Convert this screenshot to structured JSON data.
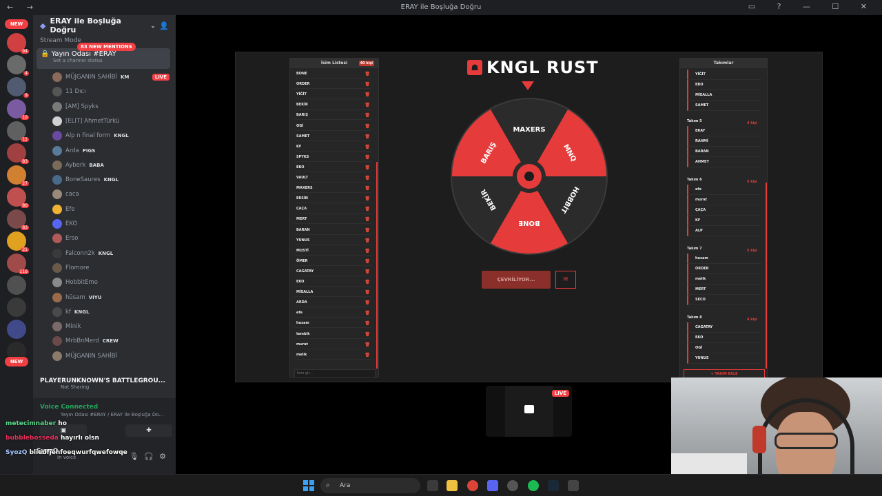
{
  "window": {
    "title": "ERAY ile Boşluğa Doğru",
    "nav": "← →",
    "controls": "▭ ? — ☐ ✕"
  },
  "servers": {
    "new_top": "NEW",
    "new_bottom": "NEW",
    "badges": [
      "94",
      "4",
      "9",
      "10",
      "11",
      "83",
      "27",
      "80",
      "83",
      "21",
      "116"
    ]
  },
  "sidebar": {
    "server_name": "ERAY ile Boşluğa Doğru",
    "stream_mode": "Stream Mode",
    "mentions": "83 NEW MENTIONS",
    "current_channel": "Yayın Odası #ERAY",
    "channel_status": "Set a channel status",
    "members": [
      {
        "name": "MÜJGANIN SAHİBİ",
        "tag": "KM",
        "live": "LIVE",
        "color": "#8a6a5a"
      },
      {
        "name": "11 Dıcı",
        "tag": "",
        "color": "#555"
      },
      {
        "name": "[AM] Spyks",
        "tag": "",
        "color": "#7a7a7a"
      },
      {
        "name": "[ELIT] AhmetTürkü",
        "tag": "",
        "color": "#d0d0d0"
      },
      {
        "name": "Alp n final form",
        "tag": "KNGL",
        "color": "#6a4aa0"
      },
      {
        "name": "Arda",
        "tag": "PIGS",
        "color": "#5a7a9a"
      },
      {
        "name": "Ayberk",
        "tag": "BABA",
        "color": "#7a6a5a"
      },
      {
        "name": "BoneSaures",
        "tag": "KNGL",
        "color": "#4a6a8a"
      },
      {
        "name": "caca",
        "tag": "",
        "color": "#9a8a7a"
      },
      {
        "name": "Efe",
        "tag": "",
        "color": "#f0b232"
      },
      {
        "name": "EKO",
        "tag": "",
        "color": "#5865f2"
      },
      {
        "name": "Erso",
        "tag": "",
        "color": "#b05a5a"
      },
      {
        "name": "Falconn2k",
        "tag": "KNGL",
        "color": "#3a3a3a"
      },
      {
        "name": "Flomore",
        "tag": "",
        "color": "#6a5a4a"
      },
      {
        "name": "HobbitEmo",
        "tag": "",
        "color": "#8a8a8a"
      },
      {
        "name": "hüsam",
        "tag": "VIYU",
        "color": "#9a6a4a"
      },
      {
        "name": "kf",
        "tag": "KNGL",
        "color": "#4a4a4a"
      },
      {
        "name": "Minik",
        "tag": "",
        "color": "#7a6a6a"
      },
      {
        "name": "MrbBnMerd",
        "tag": "CREW",
        "color": "#6a4a4a"
      },
      {
        "name": "MÜJGANIN SAHİBİ",
        "tag": "",
        "color": "#8a7a6a"
      }
    ],
    "activity_title": "PLAYERUNKNOWN'S BATTLEGROU...",
    "activity_sub": "Not Sharing",
    "voice_status": "Voice Connected",
    "voice_channel": "Yayın Odası #ERAY / ERAY ile Boşluğa Do...",
    "user_name": "SyozQ",
    "user_status": "In voice"
  },
  "chat_overlay": [
    {
      "user": "metecimnaber",
      "msg": "ho"
    },
    {
      "user": "bubblebosseda",
      "msg": "hayırlı olsn"
    },
    {
      "user": "SyozQ",
      "msg": "bliedfjehfoeqwurfqwefowqe"
    }
  ],
  "stream": {
    "brand": "KNGL RUST",
    "name_list_title": "İsim Listesi",
    "name_count": "40 kişi",
    "names": [
      "BONE",
      "ORDER",
      "YİĞİT",
      "BEKİR",
      "BARIŞ",
      "OGİ",
      "SAMET",
      "KF",
      "SPYKS",
      "EBO",
      "VAULT",
      "MAXERS",
      "ERSİN",
      "ÇAÇA",
      "MERT",
      "BARAN",
      "YUNUS",
      "MUSTİ",
      "ÖMER",
      "CAGATAY",
      "EKO",
      "MİEALLA",
      "ARDA",
      "efe",
      "husam",
      "tembik",
      "murat",
      "melik"
    ],
    "name_placeholder": "İsim gir...",
    "wheel_segments": [
      "MAXERS",
      "MNQ",
      "HOBBİT",
      "BONE",
      "BEKİR",
      "BARIŞ"
    ],
    "spin_label": "ÇEVRİLİYOR...",
    "settings_icon": "≡",
    "teams_title": "Takımlar",
    "teams": [
      {
        "name": "",
        "count": "",
        "members": [
          "YİĞİT",
          "EBO",
          "MİEALLA",
          "SAMET"
        ]
      },
      {
        "name": "Takım 5",
        "count": "4 kişi",
        "members": [
          "ERAY",
          "RAHMİ",
          "BARAN",
          "AHMET"
        ]
      },
      {
        "name": "Takım 6",
        "count": "5 kişi",
        "members": [
          "efe",
          "murat",
          "ÇAÇA",
          "KF",
          "ALP"
        ]
      },
      {
        "name": "Takım 7",
        "count": "5 kişi",
        "members": [
          "husam",
          "ORDER",
          "melik",
          "MERT",
          "SECO"
        ]
      },
      {
        "name": "Takım 8",
        "count": "4 kişi",
        "members": [
          "CAGATAY",
          "EKO",
          "OGİ",
          "YUNUS"
        ]
      }
    ],
    "add_team": "+ TAKIM EKLE"
  },
  "thumb": {
    "live": "LIVE"
  },
  "taskbar": {
    "search": "Ara"
  },
  "colors": {
    "accent": "#e53b3b",
    "wheel_dark": "#2b2b2b",
    "discord_green": "#23a55a"
  }
}
